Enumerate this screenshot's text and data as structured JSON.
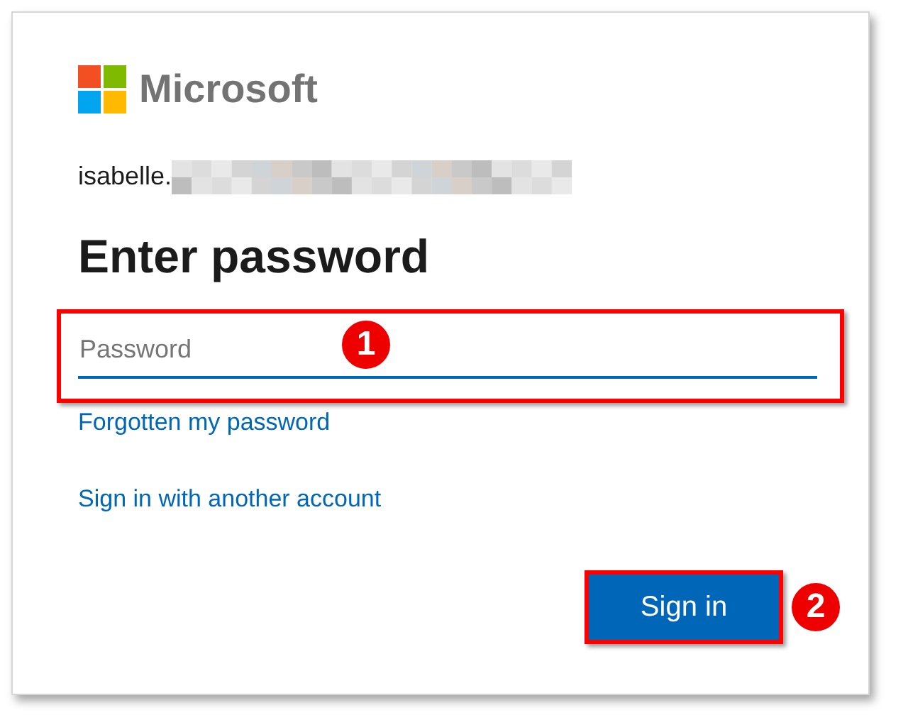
{
  "logo": {
    "text": "Microsoft"
  },
  "account": {
    "email_shown": "isabelle."
  },
  "heading": "Enter password",
  "password_field": {
    "placeholder": "Password",
    "step": "1"
  },
  "links": [
    "Forgotten my password",
    "Sign in with another account"
  ],
  "sign_in_button": {
    "label": "Sign in",
    "step": "2"
  }
}
